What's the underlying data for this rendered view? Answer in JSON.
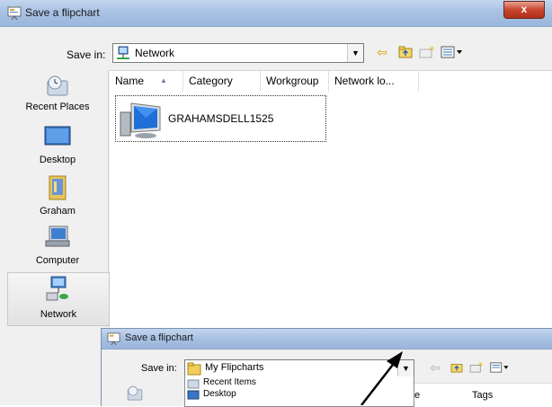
{
  "dialog": {
    "title": "Save a flipchart",
    "close_label": "x",
    "save_in_label": "Save in:",
    "save_in_value": "Network",
    "columns": [
      "Name",
      "Category",
      "Workgroup",
      "Network lo..."
    ],
    "items": [
      {
        "name": "GRAHAMSDELL1525",
        "icon": "network-computer-icon"
      }
    ],
    "places": [
      {
        "label": "Recent Places",
        "icon": "recent-places-icon"
      },
      {
        "label": "Desktop",
        "icon": "desktop-icon"
      },
      {
        "label": "Graham",
        "icon": "user-folder-icon"
      },
      {
        "label": "Computer",
        "icon": "computer-icon"
      },
      {
        "label": "Network",
        "icon": "network-icon"
      }
    ]
  },
  "dialog2": {
    "title": "Save a flipchart",
    "save_in_label": "Save in:",
    "save_in_value": "My Flipcharts",
    "dropdown_items": [
      "Recent Items",
      "Desktop"
    ],
    "col_e": "e",
    "col_tags": "Tags"
  },
  "colors": {
    "titlebar": "#a9c2e3",
    "accent": "#3a6fb3"
  }
}
